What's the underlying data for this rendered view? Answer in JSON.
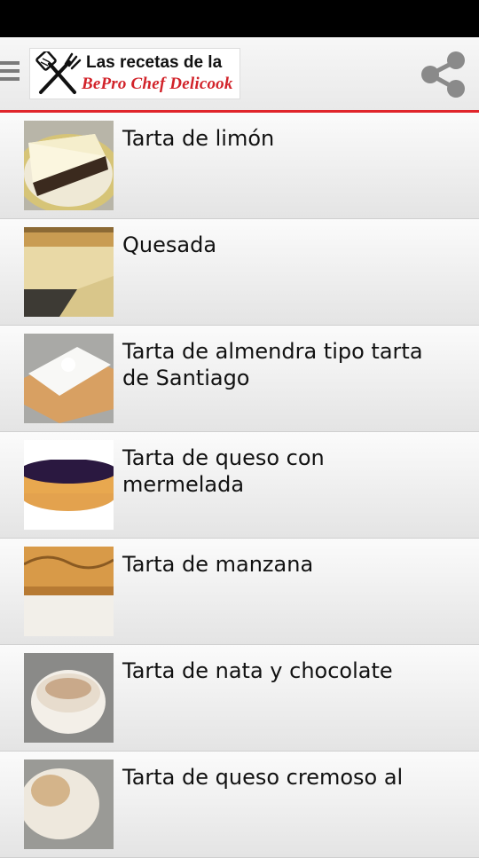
{
  "app": {
    "logo_line1": "Las recetas de la",
    "logo_line2": "BePro Chef Delicook",
    "accent_color": "#e0252b"
  },
  "toolbar": {
    "menu_icon": "menu-icon",
    "share_icon": "share-icon"
  },
  "recipes": [
    {
      "title": "Tarta de limón",
      "thumb": "lemon-cake-photo"
    },
    {
      "title": "Quesada",
      "thumb": "quesada-photo"
    },
    {
      "title": "Tarta de almendra tipo tarta de Santiago",
      "thumb": "almond-cake-photo"
    },
    {
      "title": "Tarta de queso con mermelada",
      "thumb": "cheesecake-jam-photo"
    },
    {
      "title": "Tarta de manzana",
      "thumb": "apple-cake-photo"
    },
    {
      "title": "Tarta de nata y chocolate",
      "thumb": "cream-chocolate-cake-photo"
    },
    {
      "title": "Tarta de queso cremoso al",
      "thumb": "creamy-cheesecake-photo"
    }
  ]
}
